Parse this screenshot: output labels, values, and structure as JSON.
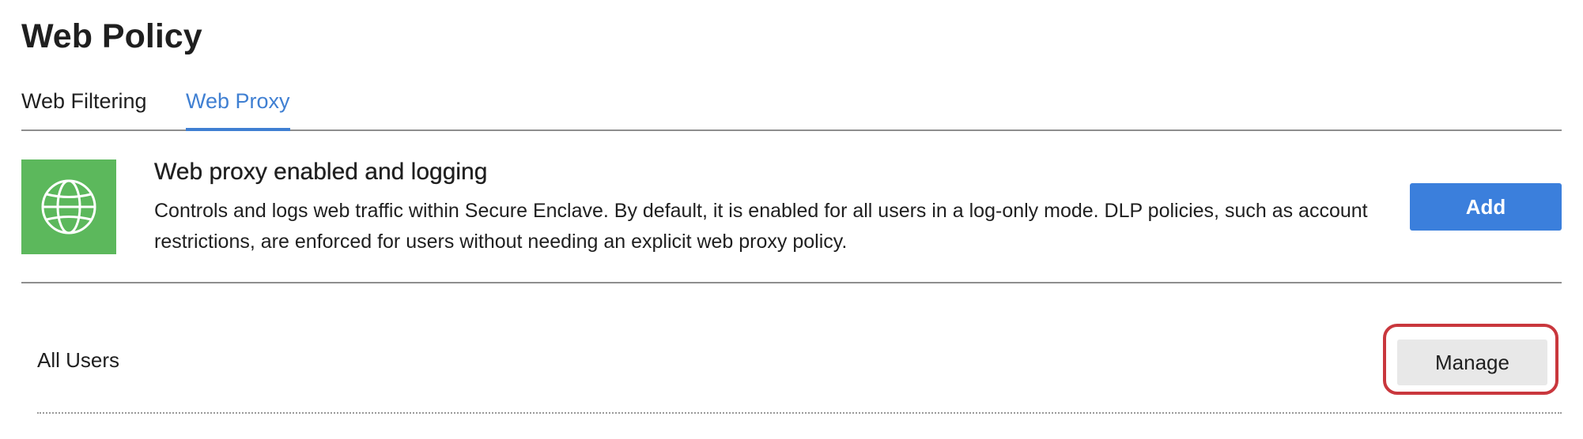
{
  "page": {
    "title": "Web Policy"
  },
  "tabs": [
    {
      "label": "Web Filtering",
      "active": false
    },
    {
      "label": "Web Proxy",
      "active": true
    }
  ],
  "info": {
    "icon": "globe-icon",
    "title": "Web proxy enabled and logging",
    "description": "Controls and logs web traffic within Secure Enclave. By default, it is enabled for all users in a log-only mode. DLP policies, such as account restrictions, are enforced for users without needing an explicit web proxy policy.",
    "add_label": "Add"
  },
  "users": [
    {
      "label": "All Users",
      "action_label": "Manage"
    }
  ],
  "colors": {
    "accent": "#3f7fd2",
    "icon_tile": "#5cb85c",
    "highlight": "#c9373d"
  }
}
